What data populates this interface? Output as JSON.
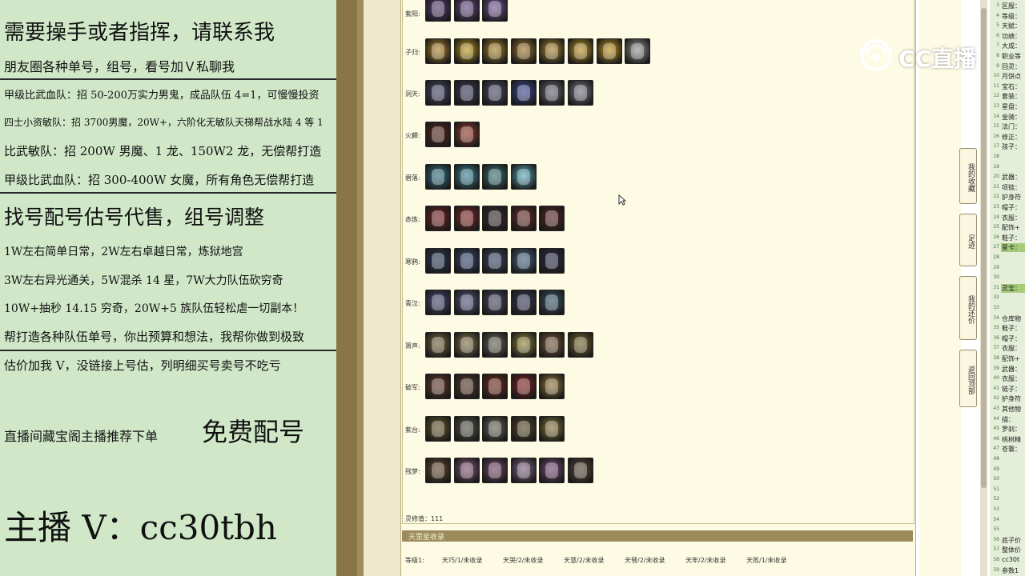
{
  "left_panel": {
    "lines": [
      "需要操手或者指挥，请联系我",
      "朋友圈各种单号，组号，看号加Ｖ私聊我",
      "甲级比武血队：招 50-200万实力男鬼，成品队伍 4=1，可慢慢投资",
      "四士小资敏队：招 3700男魔，20W+，六阶化无敏队天梯帮战水陆 4 等 1",
      "比武敏队：招 200W 男魔、1 龙、150W2 龙，无偿帮打造",
      "甲级比武血队：招 300-400W 女魔，所有角色无偿帮打造",
      "找号配号估号代售，组号调整",
      "1W左右简单日常，2W左右卓越日常，炼狱地宫",
      "3W左右异光通关，5W混杀 14 星，7W大力队伍砍穷奇",
      "10W+抽秒 14.15 穷奇，20W+5 族队伍轻松虐一切副本！",
      "帮打造各种队伍单号，你出预算和想法，我帮你做到极致",
      "估价加我 V，没链接上号估，列明细买号卖号不吃亏",
      "直播间藏宝阁主播推荐下单",
      "免费配号",
      "主播 V：cc30tbh"
    ]
  },
  "main": {
    "rows": [
      {
        "label": "紫阳:",
        "icons": [
          "#5b3f7a",
          "#6a4b8c",
          "#7b5aa0"
        ]
      },
      {
        "label": "子归:",
        "icons": [
          "#b88a2a",
          "#c9a01c",
          "#b58a24",
          "#a77a2a",
          "#b0892d",
          "#c59a20",
          "#c89a1c",
          "#9a9a9a"
        ]
      },
      {
        "label": "洞天:",
        "icons": [
          "#4a4a72",
          "#3c3c5c",
          "#4e4e6e",
          "#3d4a9a",
          "#6a6a7a",
          "#7a7a8a"
        ]
      },
      {
        "label": "火麟:",
        "icons": [
          "#5a2418",
          "#a03a2a"
        ]
      },
      {
        "label": "碧落:",
        "icons": [
          "#2e7a8a",
          "#3a8aa0",
          "#3a7a7a",
          "#5ab0c0"
        ]
      },
      {
        "label": "赤炼:",
        "icons": [
          "#7a2020",
          "#8a2424",
          "#3a2a2a",
          "#6a2a24",
          "#5a2020"
        ]
      },
      {
        "label": "寒鸦:",
        "icons": [
          "#2a3a5a",
          "#3a4a7a",
          "#3a4a6a",
          "#4a6a8a",
          "#2a2a4a"
        ]
      },
      {
        "label": "青汉:",
        "icons": [
          "#4a4a7a",
          "#5a5a8a",
          "#4a4a6a",
          "#3a3a5a",
          "#3a5a6a"
        ]
      },
      {
        "label": "箫声:",
        "icons": [
          "#7a6a3a",
          "#8a7a4a",
          "#6a6a5a",
          "#9a8a3a",
          "#7a5a3a",
          "#7a6a2a"
        ]
      },
      {
        "label": "破军:",
        "icons": [
          "#6a3a2a",
          "#5a3a2a",
          "#7a2a1a",
          "#8a2020",
          "#9a7a3a"
        ]
      },
      {
        "label": "紫台:",
        "icons": [
          "#6a5a2a",
          "#5a5a4a",
          "#6a6a5a",
          "#5a4a2a",
          "#8a7a3a"
        ]
      },
      {
        "label": "残梦:",
        "icons": [
          "#6a4a2a",
          "#8a5a7a",
          "#7a4a6a",
          "#8a6a8a",
          "#7a4a7a",
          "#5a4a3a"
        ]
      }
    ],
    "total_label": "灵修值：111",
    "section_title": "天罡星收录",
    "footer_items": [
      "等级1:",
      "天巧/1/未收录",
      "天哭/2/未收录",
      "天慧/2/未收录",
      "天彗/2/未收录",
      "天牢/2/未收录",
      "天败/1/未收录"
    ]
  },
  "side_buttons": [
    "我的收藏",
    "足迹",
    "我的还价",
    "返回顶部"
  ],
  "right_col": {
    "items": [
      "区服：",
      "等级：",
      "天赋：",
      "功绩：",
      "大成：",
      "职业等",
      "回灵：",
      "月饼点",
      "宝石：",
      "套装：",
      "星盘：",
      "坐骑：",
      "法门：",
      "修正：",
      "孩子：",
      "",
      "",
      "武器：",
      "项链：",
      "护身符",
      "帽子：",
      "衣服：",
      "配饰+",
      "鞋子：",
      "星卡：",
      "",
      "",
      "",
      "灵宝：",
      "",
      "",
      "仓库物",
      "鞋子：",
      "帽子：",
      "衣服：",
      "配饰+",
      "武器：",
      "衣服：",
      "链子：",
      "护身符",
      "其他物",
      "描：",
      "罗刹：",
      "桃树精",
      "苍寰：",
      "",
      "",
      "",
      "",
      "",
      "",
      "",
      "",
      "底子价",
      "整体价",
      "cc30t",
      "参数1"
    ],
    "highlight_rows": [
      24,
      28
    ]
  },
  "logo": {
    "text": "CC直播"
  }
}
